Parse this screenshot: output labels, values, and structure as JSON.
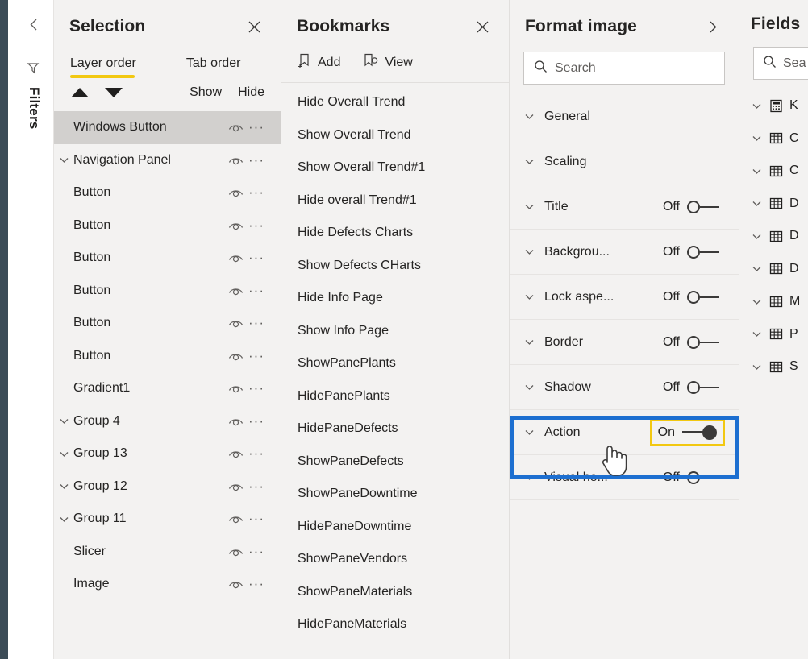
{
  "left_rail": {
    "collapse_icon": "chevron-left-icon",
    "filter_icon": "filter-funnel-icon",
    "filters_label": "Filters"
  },
  "selection_pane": {
    "title": "Selection",
    "close_icon": "close-icon",
    "tabs": [
      {
        "label": "Layer order",
        "active": true
      },
      {
        "label": "Tab order",
        "active": false
      }
    ],
    "accent_color": "#f2c811",
    "move_up_icon": "triangle-up-icon",
    "move_down_icon": "triangle-down-icon",
    "show_label": "Show",
    "hide_label": "Hide",
    "layers": [
      {
        "label": "Windows Button",
        "selected": true,
        "has_chevron": false,
        "indented": false
      },
      {
        "label": "Navigation Panel",
        "selected": false,
        "has_chevron": true,
        "indented": false
      },
      {
        "label": "Button",
        "selected": false,
        "has_chevron": false,
        "indented": false
      },
      {
        "label": "Button",
        "selected": false,
        "has_chevron": false,
        "indented": false
      },
      {
        "label": "Button",
        "selected": false,
        "has_chevron": false,
        "indented": false
      },
      {
        "label": "Button",
        "selected": false,
        "has_chevron": false,
        "indented": false
      },
      {
        "label": "Button",
        "selected": false,
        "has_chevron": false,
        "indented": false
      },
      {
        "label": "Button",
        "selected": false,
        "has_chevron": false,
        "indented": false
      },
      {
        "label": "Gradient1",
        "selected": false,
        "has_chevron": false,
        "indented": false
      },
      {
        "label": "Group 4",
        "selected": false,
        "has_chevron": true,
        "indented": false
      },
      {
        "label": "Group 13",
        "selected": false,
        "has_chevron": true,
        "indented": false
      },
      {
        "label": "Group 12",
        "selected": false,
        "has_chevron": true,
        "indented": false
      },
      {
        "label": "Group 11",
        "selected": false,
        "has_chevron": true,
        "indented": false
      },
      {
        "label": "Slicer",
        "selected": false,
        "has_chevron": false,
        "indented": false
      },
      {
        "label": "Image",
        "selected": false,
        "has_chevron": false,
        "indented": false
      }
    ]
  },
  "bookmarks_pane": {
    "title": "Bookmarks",
    "close_icon": "close-icon",
    "add_label": "Add",
    "add_icon": "bookmark-add-icon",
    "view_label": "View",
    "view_icon": "bookmark-view-icon",
    "items": [
      {
        "label": "Hide Overall Trend"
      },
      {
        "label": "Show Overall Trend"
      },
      {
        "label": "Show Overall Trend#1"
      },
      {
        "label": "Hide overall Trend#1"
      },
      {
        "label": "Hide Defects Charts"
      },
      {
        "label": "Show Defects CHarts"
      },
      {
        "label": "Hide Info Page"
      },
      {
        "label": "Show Info Page"
      },
      {
        "label": "ShowPanePlants"
      },
      {
        "label": "HidePanePlants"
      },
      {
        "label": "HidePaneDefects"
      },
      {
        "label": "ShowPaneDefects"
      },
      {
        "label": "ShowPaneDowntime"
      },
      {
        "label": "HidePaneDowntime"
      },
      {
        "label": "ShowPaneVendors"
      },
      {
        "label": "ShowPaneMaterials"
      },
      {
        "label": "HidePaneMaterials"
      }
    ]
  },
  "format_pane": {
    "title": "Format image",
    "expand_icon": "chevron-right-icon",
    "search": {
      "placeholder": "Search",
      "value": "",
      "icon": "search-icon"
    },
    "highlight_border_color": "#1d6fd0",
    "toggle_focus_color": "#f2c811",
    "cursor_icon": "hand-pointer-cursor",
    "rows": [
      {
        "label": "General",
        "has_toggle": false,
        "state": "",
        "on": false,
        "highlighted": false
      },
      {
        "label": "Scaling",
        "has_toggle": false,
        "state": "",
        "on": false,
        "highlighted": false
      },
      {
        "label": "Title",
        "has_toggle": true,
        "state": "Off",
        "on": false,
        "highlighted": false
      },
      {
        "label": "Backgrou...",
        "has_toggle": true,
        "state": "Off",
        "on": false,
        "highlighted": false
      },
      {
        "label": "Lock aspe...",
        "has_toggle": true,
        "state": "Off",
        "on": false,
        "highlighted": false
      },
      {
        "label": "Border",
        "has_toggle": true,
        "state": "Off",
        "on": false,
        "highlighted": false
      },
      {
        "label": "Shadow",
        "has_toggle": true,
        "state": "Off",
        "on": false,
        "highlighted": false
      },
      {
        "label": "Action",
        "has_toggle": true,
        "state": "On",
        "on": true,
        "highlighted": true
      },
      {
        "label": "Visual he...",
        "has_toggle": true,
        "state": "Off",
        "on": false,
        "highlighted": false
      }
    ]
  },
  "fields_pane": {
    "title": "Fields",
    "search": {
      "placeholder": "Sea",
      "value": "",
      "icon": "search-icon"
    },
    "items": [
      {
        "label": "K",
        "icon": "measure-calculator-icon"
      },
      {
        "label": "C",
        "icon": "table-icon"
      },
      {
        "label": "C",
        "icon": "table-icon"
      },
      {
        "label": "D",
        "icon": "table-icon"
      },
      {
        "label": "D",
        "icon": "table-icon"
      },
      {
        "label": "D",
        "icon": "table-icon"
      },
      {
        "label": "M",
        "icon": "table-icon"
      },
      {
        "label": "P",
        "icon": "table-icon"
      },
      {
        "label": "S",
        "icon": "table-icon"
      }
    ]
  }
}
